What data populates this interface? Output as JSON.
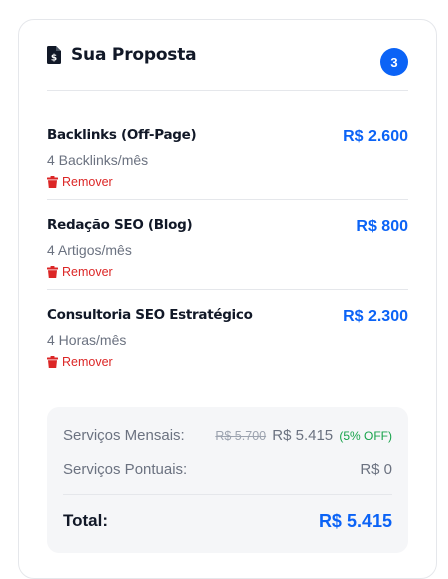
{
  "proposal": {
    "title": "Sua Proposta",
    "count": "3",
    "icon": "document-dollar-icon",
    "items": [
      {
        "name": "Backlinks (Off-Page)",
        "detail": "4 Backlinks/mês",
        "price": "R$ 2.600",
        "remove_label": "Remover"
      },
      {
        "name": "Redação SEO (Blog)",
        "detail": "4 Artigos/mês",
        "price": "R$ 800",
        "remove_label": "Remover"
      },
      {
        "name": "Consultoria SEO Estratégico",
        "detail": "4 Horas/mês",
        "price": "R$ 2.300",
        "remove_label": "Remover"
      }
    ]
  },
  "summary": {
    "monthly_label": "Serviços Mensais:",
    "monthly_old_price": "R$ 5.700",
    "monthly_price": "R$ 5.415",
    "monthly_discount": "(5% OFF)",
    "onetime_label": "Serviços Pontuais:",
    "onetime_price": "R$ 0",
    "total_label": "Total:",
    "total_value": "R$ 5.415"
  },
  "colors": {
    "accent": "#0b63f6",
    "danger": "#dc2626",
    "success": "#16a34a"
  }
}
